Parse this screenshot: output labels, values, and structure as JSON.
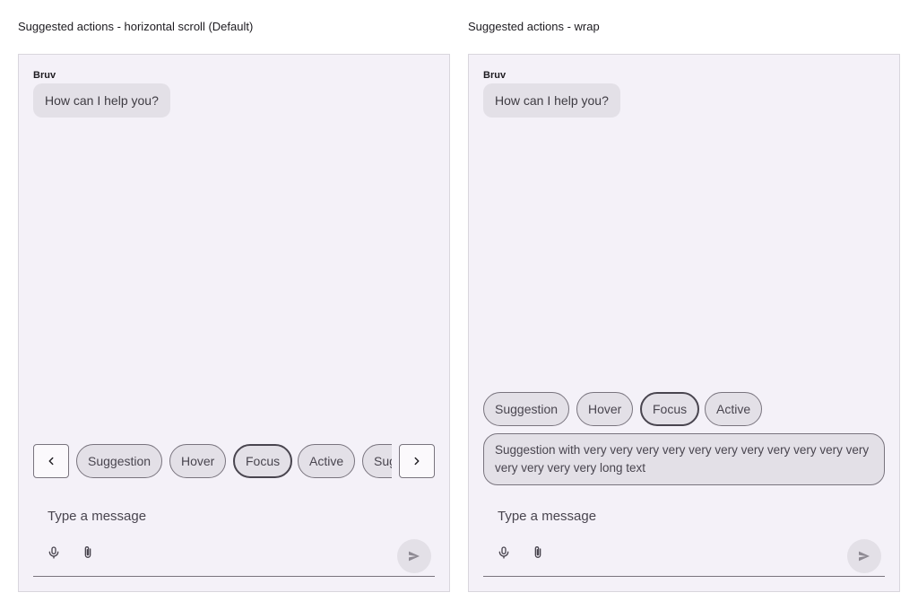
{
  "left": {
    "title": "Suggested actions - horizontal scroll (Default)",
    "sender": "Bruv",
    "message": "How can I help you?",
    "suggestions": [
      "Suggestion",
      "Hover",
      "Focus",
      "Active",
      "Suggestion"
    ],
    "composer_placeholder": "Type a message"
  },
  "right": {
    "title": "Suggested actions - wrap",
    "sender": "Bruv",
    "message": "How can I help you?",
    "suggestions": [
      "Suggestion",
      "Hover",
      "Focus",
      "Active"
    ],
    "long_suggestion": "Suggestion with very very very very very very very very very very very very very very very long text",
    "composer_placeholder": "Type a message"
  },
  "icons": {
    "prev": "chevron-left-icon",
    "next": "chevron-right-icon",
    "mic": "microphone-icon",
    "attach": "paperclip-icon",
    "send": "send-icon"
  },
  "colors": {
    "panel_bg": "#f4f1f8",
    "chip_bg": "#e3e0e7",
    "border": "#79747e",
    "text": "#1d1b20"
  }
}
